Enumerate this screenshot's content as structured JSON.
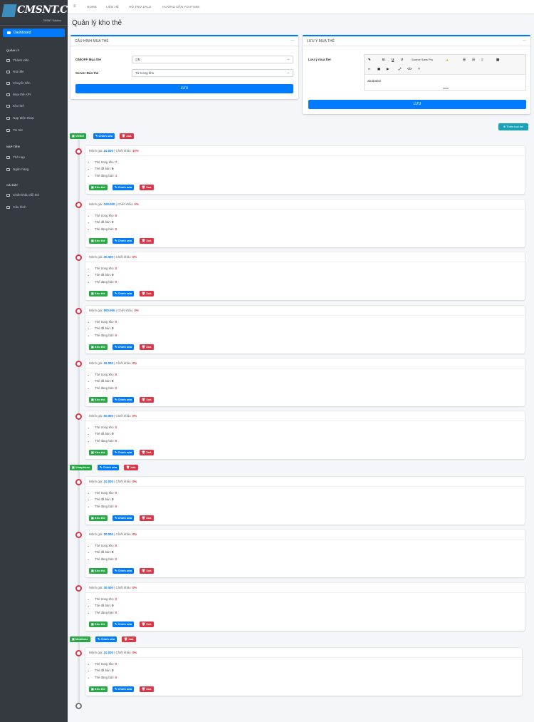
{
  "brand": {
    "name": "CMSNT.CO",
    "sub": "CMSNT Solution"
  },
  "sidebar": {
    "dashboard": "Dashboard",
    "sections": [
      {
        "title": "QUẢN LÝ",
        "items": [
          "Thành viên",
          "Rút tiền",
          "Chuyển tiền",
          "Mua thẻ API",
          "Kho thẻ",
          "Nạp điện thoại",
          "Tin tức"
        ]
      },
      {
        "title": "NẠP TIỀN",
        "items": [
          "Thẻ nạp",
          "Ngân hàng"
        ]
      },
      {
        "title": "CÀI ĐẶT",
        "items": [
          "Chiết khấu đổi thẻ",
          "Cấu hình"
        ]
      }
    ]
  },
  "topnav": {
    "menu": "≡",
    "links": [
      "HOME",
      "LIÊN HỆ",
      "HỖ TRỢ ZALO",
      "HƯỚNG DẪN YOUTUBE"
    ]
  },
  "page_title": "Quản lý kho thẻ",
  "config_card": {
    "title": "CẤU HÌNH MUA THẺ",
    "onoff_label": "ON/OFF Mua thẻ",
    "onoff_value": "ON",
    "server_label": "Server Bán thẻ",
    "server_value": "Từ trong kho",
    "save": "LƯU"
  },
  "note_card": {
    "title": "LƯU Ý MUA THẺ",
    "label": "Lưu ý mua thẻ",
    "toolbar": {
      "font": "Source Sans Pro"
    },
    "content": "abababd",
    "save": "LƯU"
  },
  "add_button": "Thêm loại thẻ",
  "actions": {
    "stock": "Kho thẻ",
    "edit": "Chỉnh sửa",
    "delete": "Xoá"
  },
  "labels": {
    "denom": "Mệnh giá:",
    "discount": "Chiết khấu:",
    "in_stock": "Thẻ trong kho:",
    "sold": "Thẻ đã bán:",
    "selling": "Thẻ đang bán:"
  },
  "groups": [
    {
      "name": "Viettel",
      "items": [
        {
          "price": "10.000",
          "discount": "10%",
          "in_stock": "7",
          "sold": "6",
          "selling": "1"
        },
        {
          "price": "100.000",
          "discount": "0%",
          "in_stock": "0",
          "sold": "0",
          "selling": "0"
        },
        {
          "price": "20.000",
          "discount": "0%",
          "in_stock": "0",
          "sold": "0",
          "selling": "0"
        },
        {
          "price": "500.000",
          "discount": "0%",
          "in_stock": "0",
          "sold": "0",
          "selling": "0"
        },
        {
          "price": "30.000",
          "discount": "0%",
          "in_stock": "0",
          "sold": "0",
          "selling": "0"
        },
        {
          "price": "50.000",
          "discount": "0%",
          "in_stock": "0",
          "sold": "0",
          "selling": "0"
        }
      ]
    },
    {
      "name": "Vinaphone",
      "items": [
        {
          "price": "10.000",
          "discount": "0%",
          "in_stock": "0",
          "sold": "0",
          "selling": "0"
        },
        {
          "price": "20.000",
          "discount": "0%",
          "in_stock": "0",
          "sold": "0",
          "selling": "0"
        },
        {
          "price": "30.000",
          "discount": "0%",
          "in_stock": "0",
          "sold": "0",
          "selling": "0"
        }
      ]
    },
    {
      "name": "Mobifone",
      "items": [
        {
          "price": "10.000",
          "discount": "0%",
          "in_stock": "0",
          "sold": "0",
          "selling": "0"
        }
      ]
    }
  ],
  "colors": {
    "primary": "#007bff",
    "success": "#28a745",
    "danger": "#dc3545",
    "info": "#17a2b8",
    "sidebar": "#343a40"
  }
}
